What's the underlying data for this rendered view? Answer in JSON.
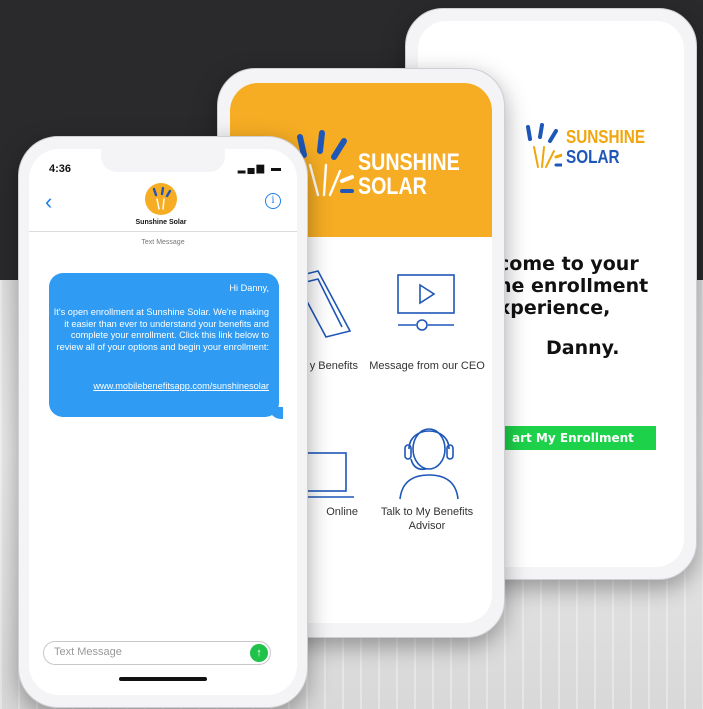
{
  "colors": {
    "brand_orange": "#f6ad24",
    "brand_blue": "#1e57b8",
    "ios_blue": "#2f9bf2",
    "cta_green": "#1dd24a",
    "background_dark": "#2a2a2c"
  },
  "welcome_screen": {
    "brand_line1": "SUNSHINE",
    "brand_line2": "SOLAR",
    "welcome_line1": "come to your",
    "welcome_line2": "ne enrollment",
    "welcome_line3": "xperience,",
    "name": "Danny.",
    "cta_label": "art My Enrollment"
  },
  "menu_screen": {
    "brand_line1": "SUNSHINE",
    "brand_line2": "SOLAR",
    "tiles": [
      {
        "label": "y Benefits",
        "icon": "book-icon"
      },
      {
        "label": "Message from our CEO",
        "icon": "video-play-icon"
      },
      {
        "label": "Online",
        "icon": "laptop-icon"
      },
      {
        "label": "Talk to My Benefits Advisor",
        "icon": "headset-person-icon"
      }
    ]
  },
  "messages_screen": {
    "status_time": "4:36",
    "contact_name": "Sunshine Solar",
    "thread_label": "Text Message",
    "message": {
      "greeting": "Hi Danny,",
      "body": "It's open enrollment at Sunshine Solar. We're making it easier than ever to understand your benefits and complete your enrollment. Click this link below to review all of your options and begin your enrollment:",
      "link": "www.mobilebenefitsapp.com/sunshinesolar"
    },
    "compose_placeholder": "Text Message"
  }
}
